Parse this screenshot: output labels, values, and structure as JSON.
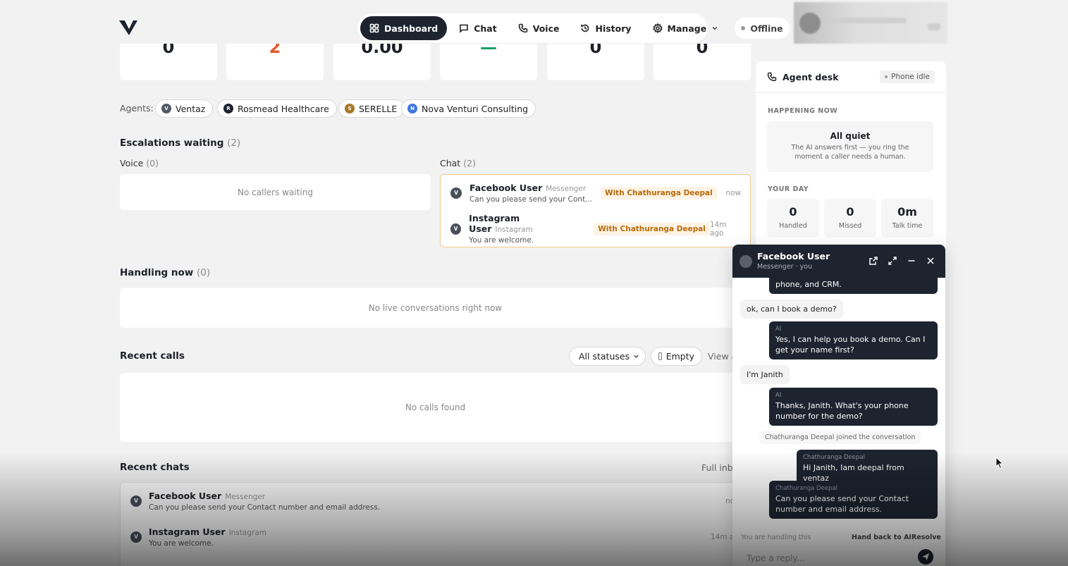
{
  "nav": {
    "dashboard": "Dashboard",
    "chat": "Chat",
    "voice": "Voice",
    "history": "History",
    "manage": "Manage"
  },
  "status": "Offline",
  "stats": [
    "0",
    "2",
    "0.00",
    "—",
    "0",
    "0"
  ],
  "agents": {
    "label": "Agents:",
    "items": [
      {
        "initial": "V",
        "name": "Ventaz",
        "color": "#555b66"
      },
      {
        "initial": "R",
        "name": "Rosmead Healthcare",
        "color": "#1d2430"
      },
      {
        "initial": "S",
        "name": "SERELLE",
        "color": "#a8782a"
      },
      {
        "initial": "N",
        "name": "Nova Venturi Consulting",
        "color": "#3f73e0"
      }
    ]
  },
  "escalations": {
    "title": "Escalations waiting",
    "count": "(2)",
    "voice_label": "Voice",
    "voice_count": "(0)",
    "voice_empty": "No callers waiting",
    "chat_label": "Chat",
    "chat_count": "(2)",
    "chats": [
      {
        "initial": "V",
        "name": "Facebook User",
        "source": "Messenger",
        "message": "Can you please send your Cont...",
        "badge": "With Chathuranga Deepal",
        "time": "now"
      },
      {
        "initial": "V",
        "name": "Instagram User",
        "source": "Instagram",
        "message": "You are welcome.",
        "badge": "With Chathuranga Deepal",
        "time": "14m ago"
      }
    ]
  },
  "handling": {
    "title": "Handling now",
    "count": "(0)",
    "empty": "No live conversations right now"
  },
  "recent_calls": {
    "title": "Recent calls",
    "filter": "All statuses",
    "empty_toggle": "Empty",
    "view_link": "View a",
    "empty": "No calls found"
  },
  "recent_chats": {
    "title": "Recent chats",
    "link": "Full inbo",
    "items": [
      {
        "initial": "V",
        "name": "Facebook User",
        "source": "Messenger",
        "message": "Can you please send your Contact number and email address.",
        "time": "no"
      },
      {
        "initial": "V",
        "name": "Instagram User",
        "source": "Instagram",
        "message": "You are welcome.",
        "time": "14m a"
      }
    ]
  },
  "desk": {
    "title": "Agent desk",
    "phone_status": "Phone idle",
    "happening_label": "HAPPENING NOW",
    "quiet_title": "All quiet",
    "quiet_text_1": "The AI answers first — you ring the",
    "quiet_text_2": "moment a caller needs a human.",
    "day_label": "YOUR DAY",
    "day": [
      {
        "value": "0",
        "label": "Handled"
      },
      {
        "value": "0",
        "label": "Missed"
      },
      {
        "value": "0m",
        "label": "Talk time"
      }
    ]
  },
  "popup": {
    "title": "Facebook User",
    "subtitle": "Messenger · you",
    "messages": {
      "m0": "phone, and CRM.",
      "m1": "ok, can I book a demo?",
      "m2_who": "AI",
      "m2": "Yes, I can help you book a demo. Can I get your name first?",
      "m3": "I'm Janith",
      "m4_who": "AI",
      "m4": "Thanks, Janith. What's your phone number for the demo?",
      "sys": "Chathuranga Deepal joined the conversation",
      "m5_who": "Chathuranga Deepal",
      "m5": "Hi Janith, Iam deepal from ventaz",
      "m6_who": "Chathuranga Deepal",
      "m6": "Can you please send your Contact number and email address."
    },
    "footer_note": "You are handling this",
    "hand_back": "Hand back to AI",
    "resolve": "Resolve",
    "reply_placeholder": "Type a reply..."
  }
}
